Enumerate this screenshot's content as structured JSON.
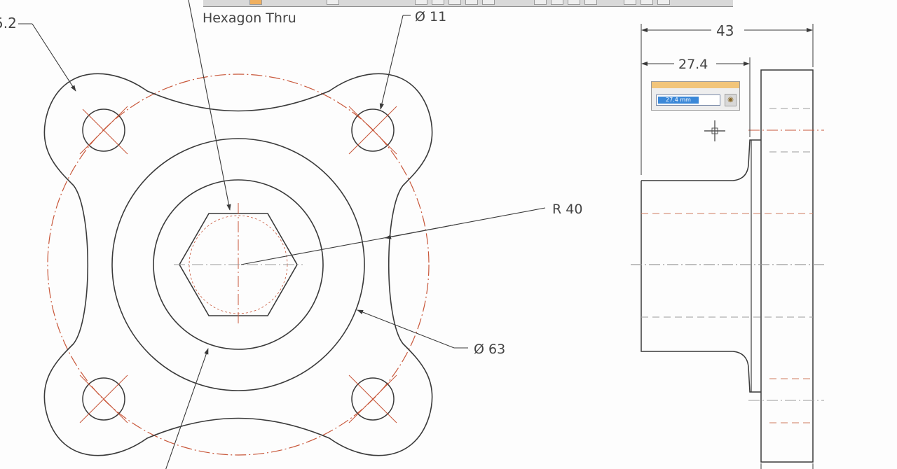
{
  "annotations": {
    "hexagon": "Hexagon Thru",
    "hole_diameter": "Ø 11",
    "corner_dim": "5.2",
    "radius": "R 40",
    "outer_diameter": "Ø 63"
  },
  "side_view": {
    "overall_width": "43",
    "hub_width": "27.4"
  },
  "edit_field": {
    "value": "27.4 mm"
  },
  "icons": {
    "lock": "lock-icon",
    "cursor": "crosshair-cursor-icon"
  },
  "colors": {
    "line": "#3a3a3a",
    "centerline": "#c8573a",
    "hidden": "#d07a5e",
    "gray_centerline": "#9a9a9a",
    "accent_selection": "#3b88d8",
    "title_bar": "#f2c57a"
  }
}
